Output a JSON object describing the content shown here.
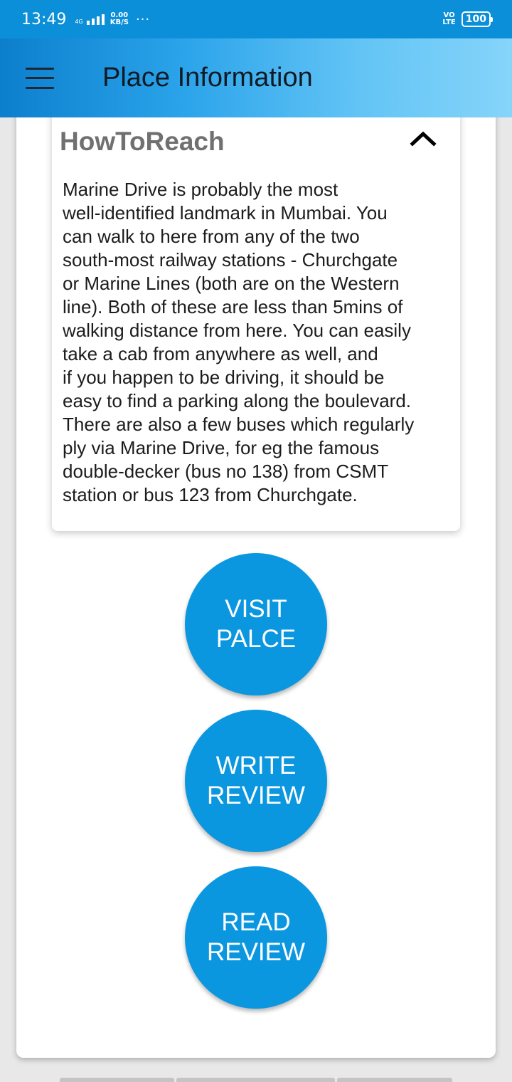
{
  "status_bar": {
    "time": "13:49",
    "network_type": "4G",
    "speed_value": "0.00",
    "speed_unit": "KB/S",
    "more": "···",
    "volte_top": "VO",
    "volte_bottom": "LTE",
    "battery": "100"
  },
  "app_bar": {
    "menu_icon": "hamburger-menu-icon",
    "title": "Place Information"
  },
  "card": {
    "title": "HowToReach",
    "collapse_icon": "chevron-up-icon",
    "body": "Marine Drive is probably the most\nwell-identified landmark in Mumbai. You\ncan walk to here from any of the two\nsouth-most railway stations - Churchgate\nor Marine Lines (both are on the Western\nline). Both of these are less than 5mins of\nwalking distance from here. You can easily\ntake a cab from anywhere as well, and\nif you happen to be driving, it should be\neasy to find a parking along the boulevard.\nThere are also a few buses which regularly\nply via Marine Drive, for eg the famous\ndouble-decker (bus no 138) from CSMT\nstation or bus 123 from Churchgate."
  },
  "actions": {
    "visit_place": "VISIT\nPALCE",
    "write_review": "WRITE\nREVIEW",
    "read_review": "READ\nREVIEW"
  },
  "colors": {
    "status_bar": "#0b8fd9",
    "button": "#0b97e0",
    "title_text": "#707070"
  }
}
